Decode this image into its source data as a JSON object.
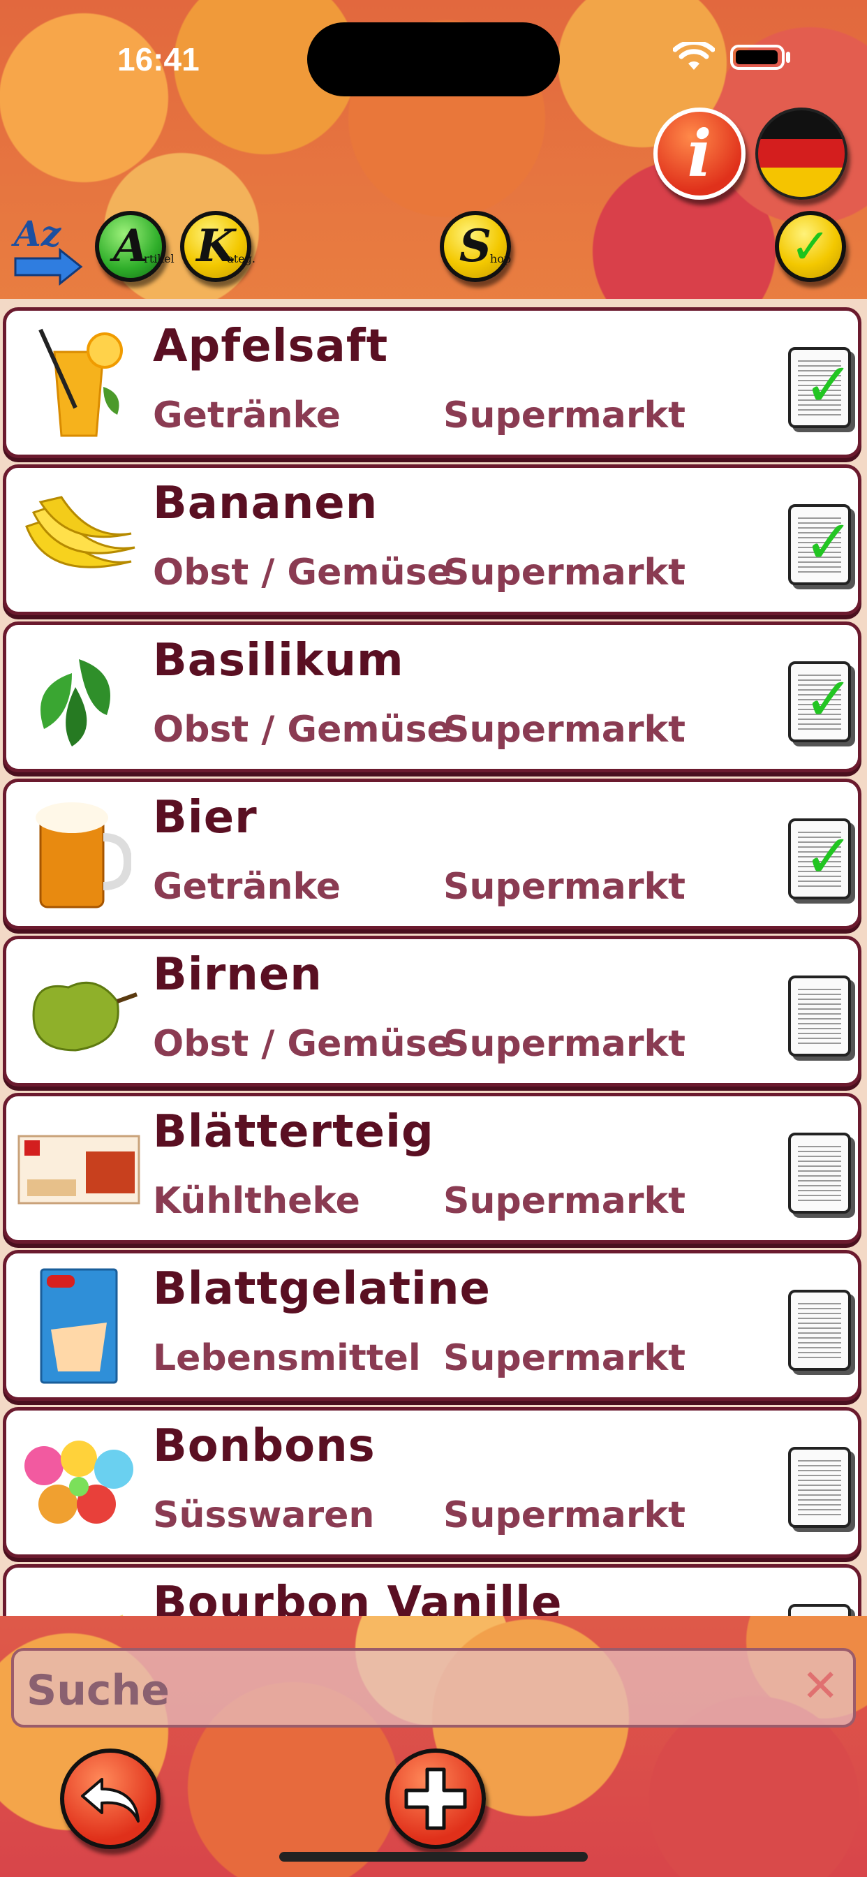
{
  "status_bar": {
    "time": "16:41"
  },
  "toolbar": {
    "info_label": "i",
    "artikel_letter": "A",
    "artikel_small": "rtikel",
    "kategorie_letter": "K",
    "kategorie_small": "ateg.",
    "shop_letter": "S",
    "shop_small": "hop",
    "check_label": "✓"
  },
  "items": [
    {
      "name": "Apfelsaft",
      "category": "Getränke",
      "shop": "Supermarkt",
      "checked": true,
      "icon": "juice-glass-icon"
    },
    {
      "name": "Bananen",
      "category": "Obst / Gemüse",
      "shop": "Supermarkt",
      "checked": true,
      "icon": "banana-icon"
    },
    {
      "name": "Basilikum",
      "category": "Obst / Gemüse",
      "shop": "Supermarkt",
      "checked": true,
      "icon": "basil-icon"
    },
    {
      "name": "Bier",
      "category": "Getränke",
      "shop": "Supermarkt",
      "checked": true,
      "icon": "beer-mug-icon"
    },
    {
      "name": "Birnen",
      "category": "Obst / Gemüse",
      "shop": "Supermarkt",
      "checked": false,
      "icon": "pear-icon"
    },
    {
      "name": "Blätterteig",
      "category": "Kühltheke",
      "shop": "Supermarkt",
      "checked": false,
      "icon": "pastry-box-icon"
    },
    {
      "name": "Blattgelatine",
      "category": "Lebensmittel",
      "shop": "Supermarkt",
      "checked": false,
      "icon": "gelatine-pack-icon"
    },
    {
      "name": "Bonbons",
      "category": "Süsswaren",
      "shop": "Supermarkt",
      "checked": false,
      "icon": "candy-icon"
    },
    {
      "name": "Bourbon Vanille",
      "category": "",
      "shop": "",
      "checked": false,
      "icon": "vanilla-icon"
    }
  ],
  "search": {
    "placeholder": "Suche",
    "clear_label": "✕"
  },
  "bottom": {
    "back_label": "↶",
    "add_label": "+"
  }
}
